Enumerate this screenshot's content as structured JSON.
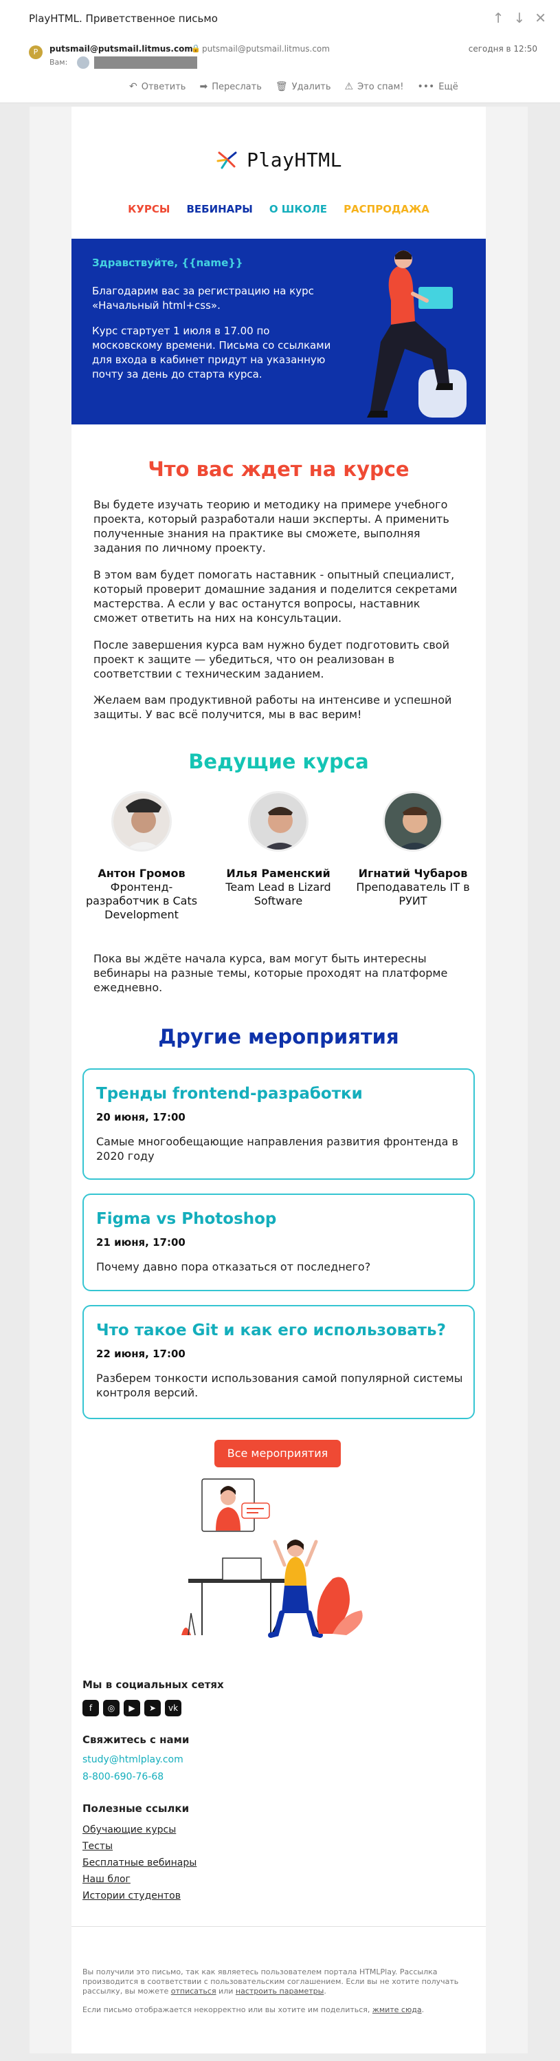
{
  "mail": {
    "subject": "PlayHTML. Приветственное письмо",
    "sender_avatar": "P",
    "sender": "putsmail@putsmail.litmus.com",
    "sender_secondary": "putsmail@putsmail.litmus.com",
    "to_label": "Вам:",
    "date": "сегодня в 12:50",
    "toolbar": [
      {
        "label": "Ответить",
        "icon": "reply-icon",
        "glyph": "↶"
      },
      {
        "label": "Переслать",
        "icon": "forward-icon",
        "glyph": "➡"
      },
      {
        "label": "Удалить",
        "icon": "trash-icon",
        "glyph": "🗑"
      },
      {
        "label": "Это спам!",
        "icon": "spam-icon",
        "glyph": "⚠"
      },
      {
        "label": "Ещё",
        "icon": "more-icon",
        "glyph": "•••"
      }
    ]
  },
  "brand": {
    "logo_text": "PlayHTML"
  },
  "menu": [
    {
      "label": "КУРСЫ",
      "color": "#ef4a34"
    },
    {
      "label": "ВЕБИНАРЫ",
      "color": "#0e32a9"
    },
    {
      "label": "О ШКОЛЕ",
      "color": "#14aebc"
    },
    {
      "label": "РАСПРОДАЖА",
      "color": "#f6b21b"
    }
  ],
  "hero": {
    "greeting": "Здравствуйте, {{name}}",
    "p1": "Благодарим вас за регистрацию на курс «Начальный html+css».",
    "p2": "Курс стартует 1 июля в 17.00 по московскому времени. Письма со ссылками для входа в кабинет придут на указанную почту за день до старта курса."
  },
  "about": {
    "title": "Что вас ждет на курсе",
    "paragraphs": [
      "Вы будете изучать теорию и методику на примере учебного проекта, который разработали наши эксперты. А применить полученные знания на практике вы сможете, выполняя задания по личному проекту.",
      "В этом вам будет помогать наставник - опытный специалист, который проверит домашние задания и поделится секретами мастерства. А если у вас останутся вопросы, наставник сможет ответить на них на консультации.",
      "После завершения курса вам нужно будет подготовить свой проект к защите — убедиться, что он реализован в соответствии с техническим заданием.",
      "Желаем вам продуктивной работы на интенсиве и успешной защиты. У вас всё получится, мы в вас верим!"
    ]
  },
  "mentors": {
    "title": "Ведущие курса",
    "items": [
      {
        "name": "Антон Громов",
        "role": "Фронтенд-разработчик в Cats Development"
      },
      {
        "name": "Илья Раменский",
        "role": "Team Lead в Lizard Software"
      },
      {
        "name": "Игнатий Чубаров",
        "role": "Преподаватель IT в РУИТ"
      }
    ],
    "note": "Пока вы ждёте начала курса, вам могут быть интересны вебинары на разные темы, которые проходят на платформе ежедневно."
  },
  "events": {
    "title": "Другие мероприятия",
    "items": [
      {
        "title": "Тренды frontend-разработки",
        "date": "20 июня, 17:00",
        "desc": "Самые многообещающие направления развития фронтенда в 2020 году"
      },
      {
        "title": "Figma vs Photoshop",
        "date": "21 июня, 17:00",
        "desc": "Почему давно пора отказаться от последнего?"
      },
      {
        "title": "Что такое Git и как его использовать?",
        "date": "22 июня, 17:00",
        "desc": "Разберем тонкости использования самой популярной системы контроля версий."
      }
    ],
    "button": "Все мероприятия"
  },
  "footer": {
    "social_title": "Мы в социальных сетях",
    "social": [
      {
        "icon": "facebook-icon",
        "glyph": "f"
      },
      {
        "icon": "instagram-icon",
        "glyph": "◎"
      },
      {
        "icon": "youtube-icon",
        "glyph": "▶"
      },
      {
        "icon": "telegram-icon",
        "glyph": "➤"
      },
      {
        "icon": "vk-icon",
        "glyph": "vk"
      }
    ],
    "contact_title": "Свяжитесь с нами",
    "email": "study@htmlplay.com",
    "phone": "8-800-690-76-68",
    "links_title": "Полезные ссылки",
    "links": [
      "Обучающие курсы",
      "Тесты",
      "Бесплатные вебинары",
      "Наш блог",
      "Истории студентов"
    ],
    "legal1_a": "Вы получили это письмо, так как являетесь пользователем портала HTMLPlay. Рассылка производится в соответствии с пользовательским соглашением. Если вы не хотите получать рассылку, вы можете ",
    "legal1_unsub": "отписаться",
    "legal1_b": " или ",
    "legal1_settings": "настроить параметры",
    "legal1_end": ".",
    "legal2_a": "Если письмо отображается некорректно или вы хотите им поделиться, ",
    "legal2_link": "жмите сюда",
    "legal2_end": "."
  }
}
